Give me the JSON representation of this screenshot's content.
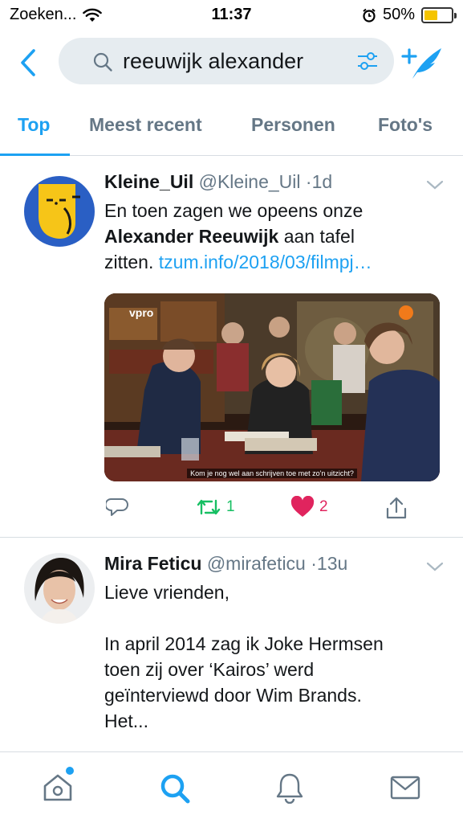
{
  "status_bar": {
    "carrier": "Zoeken...",
    "time": "11:37",
    "battery": "50%",
    "battery_level": 0.5,
    "battery_color": "#f5c400"
  },
  "search": {
    "query": "reeuwijk alexander"
  },
  "tabs": [
    {
      "label": "Top",
      "active": true
    },
    {
      "label": "Meest recent",
      "active": false
    },
    {
      "label": "Personen",
      "active": false
    },
    {
      "label": "Foto's",
      "active": false
    }
  ],
  "tweets": [
    {
      "name": "Kleine_Uil",
      "handle": "@Kleine_Uil",
      "time": "1d",
      "text_line1": "En toen zagen we opeens onze",
      "text_bold": "Alexander Reeuwijk",
      "text_after_bold": " aan tafel",
      "text_line3": "zitten. ",
      "link": "tzum.info/2018/03/filmpj…",
      "media_logo": "vpro",
      "media_caption": "Kom je nog wel aan schrijven toe met zo'n uitzicht?",
      "retweets": "1",
      "likes": "2"
    },
    {
      "name": "Mira Feticu",
      "handle": "@mirafeticu",
      "time": "13u",
      "line1": "Lieve vrienden,",
      "line2": "In april 2014 zag ik Joke Hermsen",
      "line3": "toen zij over ‘Kairos’ werd",
      "line4": "geïnterviewd door Wim Brands.",
      "line5": "Het..."
    }
  ],
  "icons": [
    "wifi-icon",
    "alarm-icon",
    "battery-icon",
    "back-icon",
    "search-icon",
    "filter-icon",
    "compose-icon",
    "chevron-down-icon",
    "reply-icon",
    "retweet-icon",
    "like-icon",
    "share-icon",
    "home-icon",
    "explore-icon",
    "notifications-icon",
    "messages-icon"
  ],
  "colors": {
    "accent": "#1da1f2",
    "retweet": "#17bf63",
    "like": "#e0245e",
    "secondary_text": "#657786"
  }
}
